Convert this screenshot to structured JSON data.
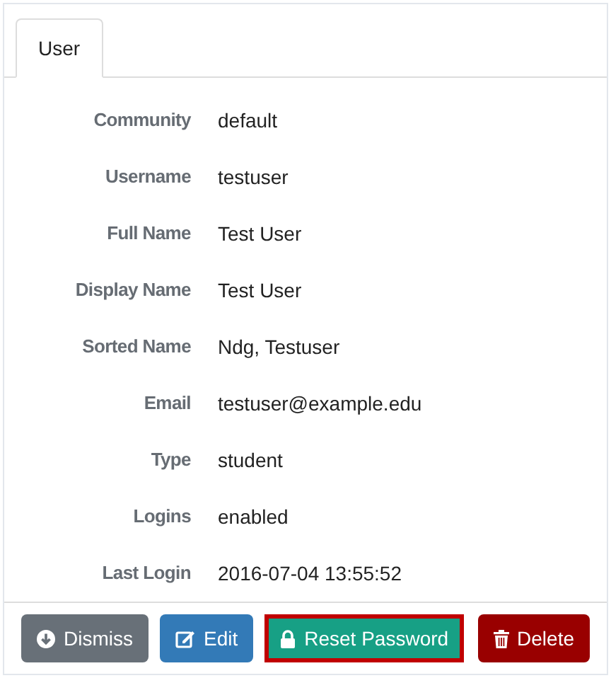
{
  "tabs": [
    {
      "label": "User",
      "selected": true
    }
  ],
  "fields": [
    {
      "label": "Community",
      "value": "default"
    },
    {
      "label": "Username",
      "value": "testuser"
    },
    {
      "label": "Full Name",
      "value": "Test User"
    },
    {
      "label": "Display Name",
      "value": "Test User"
    },
    {
      "label": "Sorted Name",
      "value": "Ndg, Testuser"
    },
    {
      "label": "Email",
      "value": "testuser@example.edu"
    },
    {
      "label": "Type",
      "value": "student"
    },
    {
      "label": "Logins",
      "value": "enabled"
    },
    {
      "label": "Last Login",
      "value": "2016-07-04 13:55:52"
    }
  ],
  "buttons": [
    {
      "kind": "dismiss",
      "label": "Dismiss",
      "focused": false
    },
    {
      "kind": "edit",
      "label": "Edit",
      "focused": false
    },
    {
      "kind": "reset",
      "label": "Reset Password",
      "focused": true
    },
    {
      "kind": "delete",
      "label": "Delete",
      "focused": false
    }
  ]
}
